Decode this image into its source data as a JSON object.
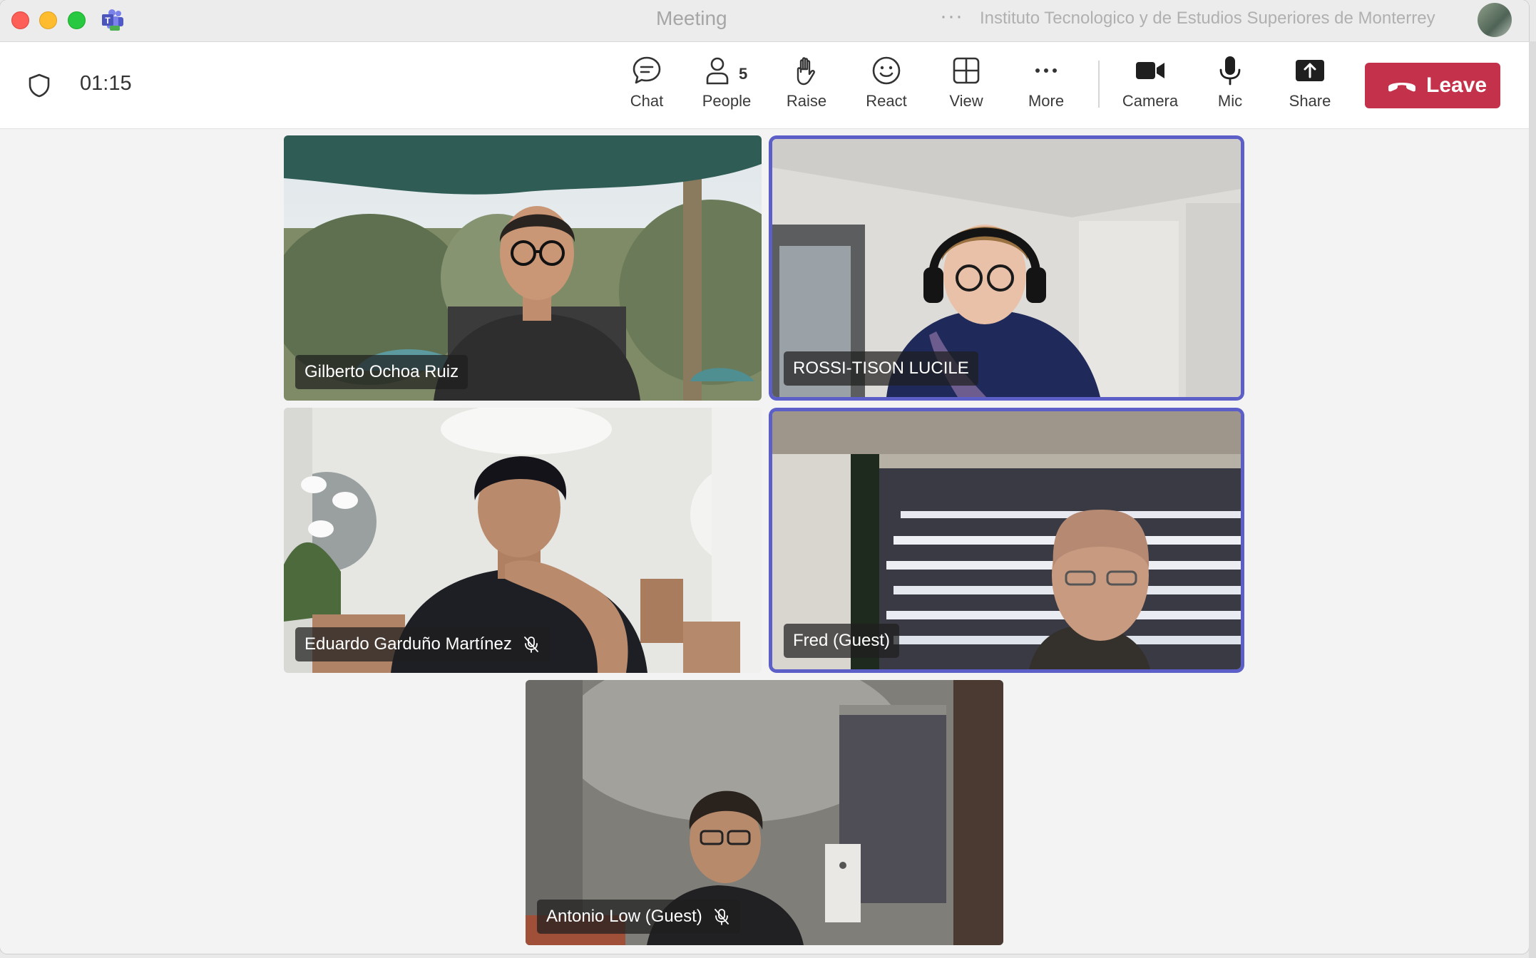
{
  "window": {
    "title": "Meeting",
    "more_dots": "···",
    "organization": "Instituto Tecnologico y de Estudios Superiores de Monterrey"
  },
  "toolbar": {
    "timer": "01:15",
    "chat_label": "Chat",
    "people_label": "People",
    "people_count": "5",
    "raise_label": "Raise",
    "react_label": "React",
    "view_label": "View",
    "more_label": "More",
    "camera_label": "Camera",
    "mic_label": "Mic",
    "share_label": "Share",
    "leave_label": "Leave"
  },
  "participants": [
    {
      "name": "Gilberto Ochoa Ruiz",
      "muted": false,
      "speaking": false
    },
    {
      "name": "ROSSI-TISON LUCILE",
      "muted": false,
      "speaking": true
    },
    {
      "name": "Eduardo Garduño Martínez",
      "muted": true,
      "speaking": false
    },
    {
      "name": "Fred (Guest)",
      "muted": false,
      "speaking": true
    },
    {
      "name": "Antonio Low (Guest)",
      "muted": true,
      "speaking": false
    }
  ],
  "colors": {
    "accent": "#5b5fc7",
    "leave": "#c4314b"
  }
}
